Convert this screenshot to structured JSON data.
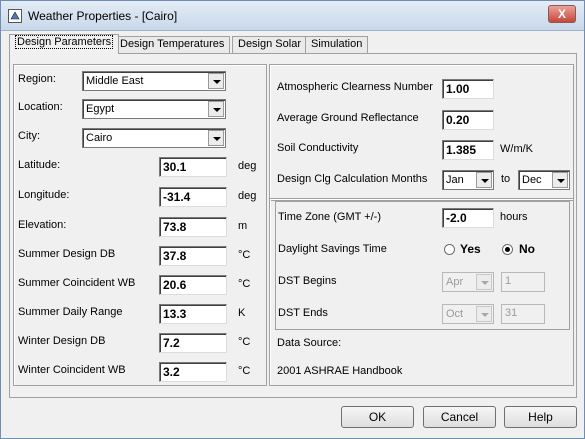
{
  "window": {
    "title": "Weather Properties - [Cairo]",
    "close_symbol": "X"
  },
  "tabs": [
    {
      "label": "Design Parameters",
      "active": true
    },
    {
      "label": "Design Temperatures",
      "active": false
    },
    {
      "label": "Design Solar",
      "active": false
    },
    {
      "label": "Simulation",
      "active": false
    }
  ],
  "left": {
    "region": {
      "label": "Region:",
      "value": "Middle East"
    },
    "location": {
      "label": "Location:",
      "value": "Egypt"
    },
    "city": {
      "label": "City:",
      "value": "Cairo"
    },
    "latitude": {
      "label": "Latitude:",
      "value": "30.1",
      "unit": "deg"
    },
    "longitude": {
      "label": "Longitude:",
      "value": "-31.4",
      "unit": "deg"
    },
    "elevation": {
      "label": "Elevation:",
      "value": "73.8",
      "unit": "m"
    },
    "summer_db": {
      "label": "Summer Design DB",
      "value": "37.8",
      "unit": "°C"
    },
    "summer_wb": {
      "label": "Summer Coincident WB",
      "value": "20.6",
      "unit": "°C"
    },
    "summer_range": {
      "label": "Summer Daily Range",
      "value": "13.3",
      "unit": "K"
    },
    "winter_db": {
      "label": "Winter Design DB",
      "value": "7.2",
      "unit": "°C"
    },
    "winter_wb": {
      "label": "Winter Coincident WB",
      "value": "3.2",
      "unit": "°C"
    }
  },
  "right": {
    "clearness": {
      "label": "Atmospheric Clearness Number",
      "value": "1.00"
    },
    "ground_reflectance": {
      "label": "Average Ground Reflectance",
      "value": "0.20"
    },
    "soil": {
      "label": "Soil Conductivity",
      "value": "1.385",
      "unit": "W/m/K"
    },
    "clg_months": {
      "label": "Design Clg Calculation Months",
      "from": "Jan",
      "to_label": "to",
      "to": "Dec"
    },
    "timezone": {
      "label": "Time Zone (GMT +/-)",
      "value": "-2.0",
      "unit": "hours"
    },
    "dst": {
      "label": "Daylight Savings Time",
      "yes": "Yes",
      "no": "No",
      "selected": "No"
    },
    "dst_begins": {
      "label": "DST Begins",
      "month": "Apr",
      "day": "1"
    },
    "dst_ends": {
      "label": "DST Ends",
      "month": "Oct",
      "day": "31"
    },
    "data_source": {
      "label": "Data Source:",
      "value": "2001 ASHRAE Handbook"
    }
  },
  "buttons": {
    "ok": "OK",
    "cancel": "Cancel",
    "help": "Help"
  }
}
